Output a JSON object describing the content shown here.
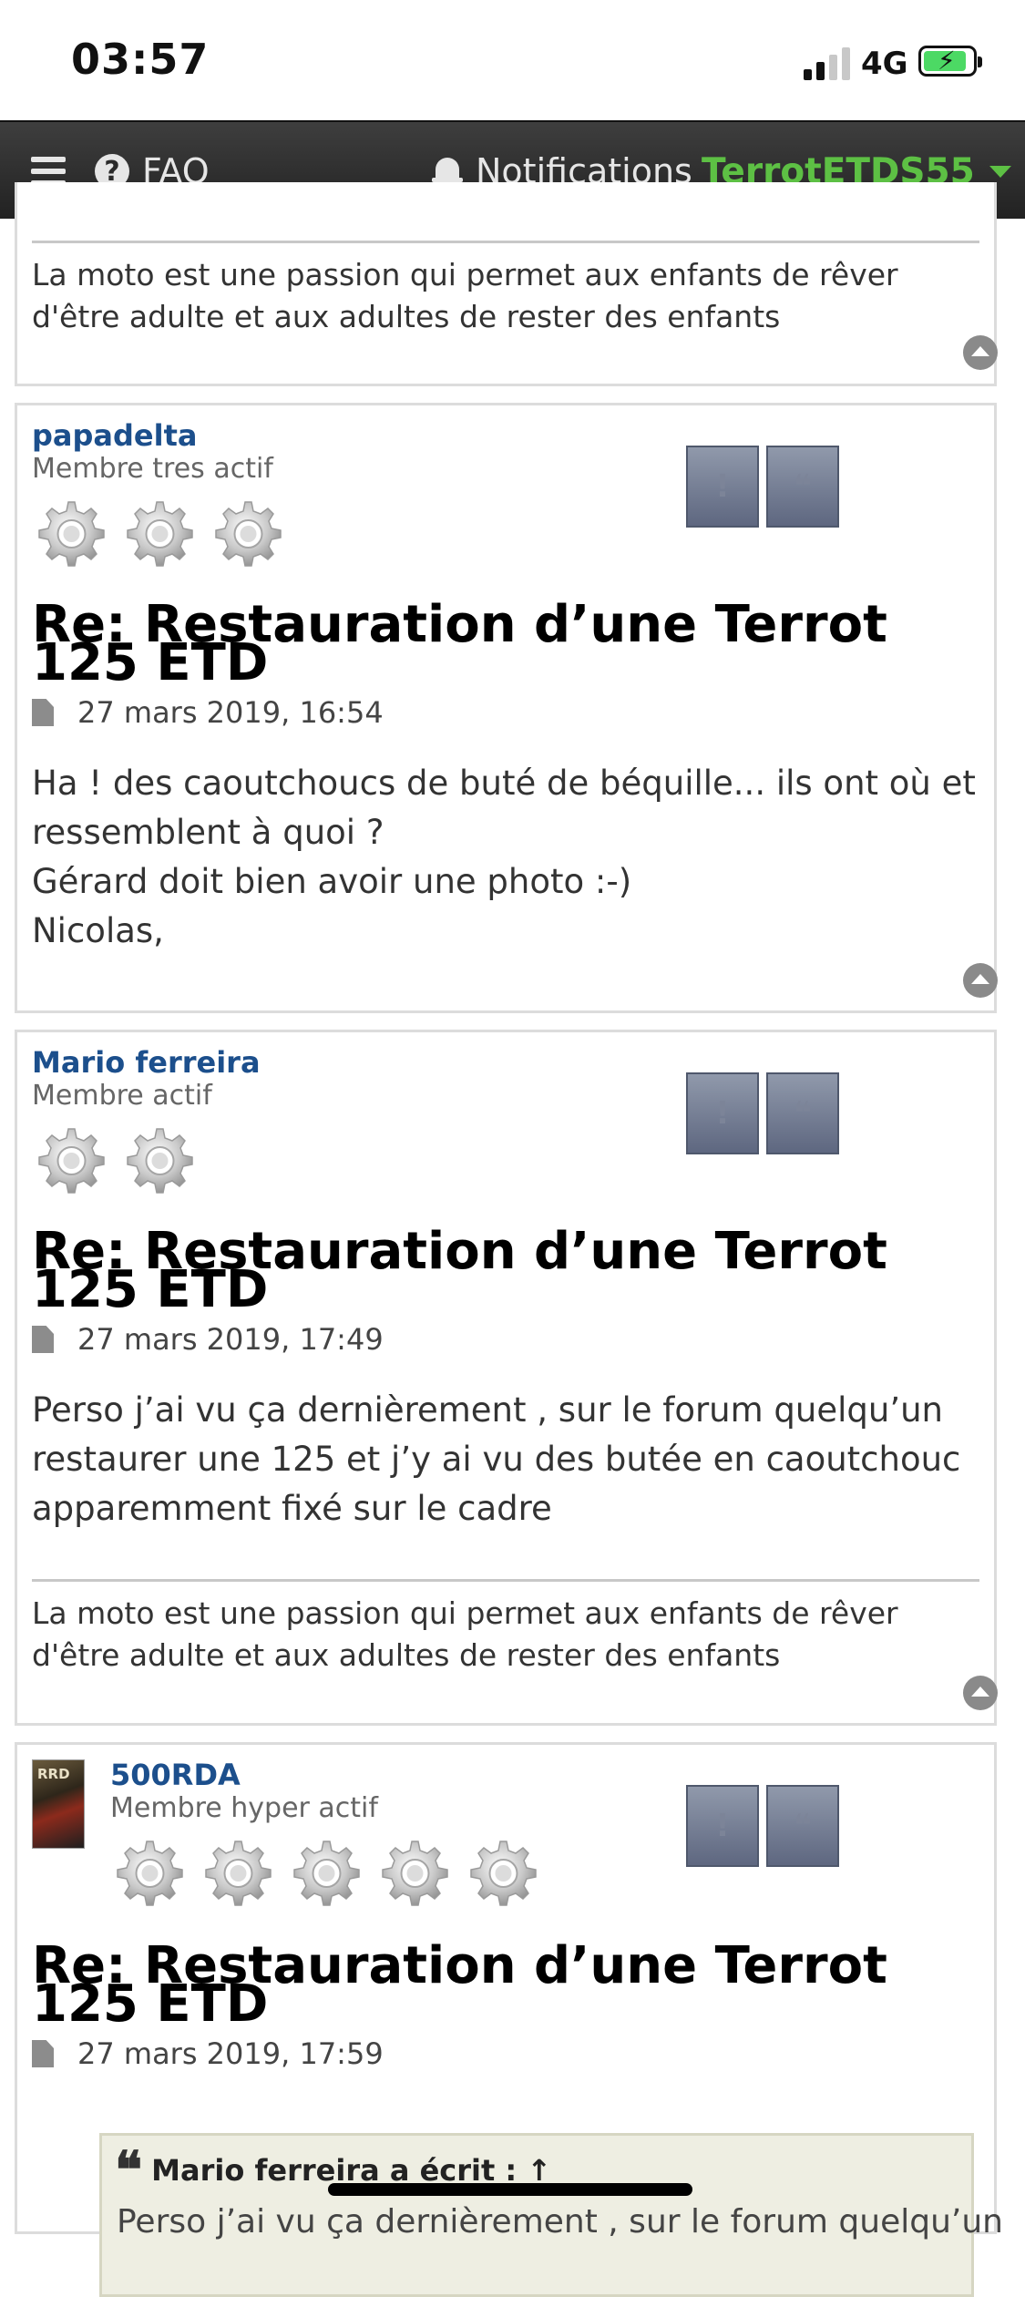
{
  "status_bar": {
    "time": "03:57",
    "network": "4G"
  },
  "navbar": {
    "faq_label": "FAQ",
    "notifications_label": "Notifications",
    "username": "TerrotETDS55"
  },
  "posts": [
    {
      "signature": "La moto est une passion qui permet aux enfants de rêver d'être adulte et aux adultes de rester des enfants"
    },
    {
      "author": "papadelta",
      "rank": "Membre tres actif",
      "title": "Re: Restauration d’une Terrot 125 ETD",
      "date": "27 mars 2019, 16:54",
      "content_lines": [
        "Ha ! des caoutchoucs de buté de béquille... ils ont où et ressemblent à quoi ?",
        "Gérard doit bien avoir une photo :-)",
        "Nicolas,"
      ]
    },
    {
      "author": "Mario ferreira",
      "rank": "Membre actif",
      "title": "Re: Restauration d’une Terrot 125 ETD",
      "date": "27 mars 2019, 17:49",
      "content": "Perso j’ai vu ça dernièrement , sur le forum quelqu’un restaurer une 125 et j’y ai vu des butée en caoutchouc apparemment fixé sur le cadre",
      "signature": "La moto est une passion qui permet aux enfants de rêver d'être adulte et aux adultes de rester des enfants"
    },
    {
      "author": "500RDA",
      "rank": "Membre hyper actif",
      "avatar_text": "RRD",
      "title": "Re: Restauration d’une Terrot 125 ETD",
      "date": "27 mars 2019, 17:59",
      "quote_header": "Mario ferreira a écrit : ↑",
      "quote_text": "Perso j’ai vu ça dernièrement , sur le forum quelqu’un"
    }
  ],
  "icons": {
    "report": "exclamation-icon",
    "quote": "quote-icon",
    "back_to_top": "chevron-up-icon",
    "rank_gear": "gear-icon",
    "post_date": "document-icon"
  },
  "colors": {
    "username_green": "#5dc044",
    "author_blue": "#1c4f8c",
    "navbar_bg": "#2b2b2b",
    "quote_bg": "#eeeee2"
  }
}
